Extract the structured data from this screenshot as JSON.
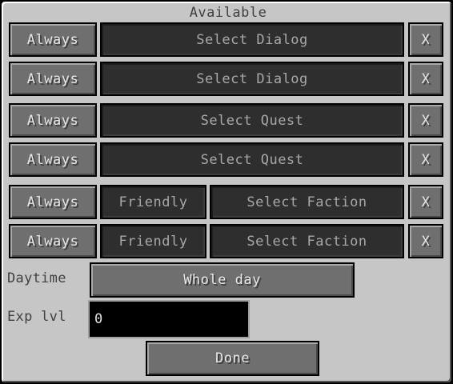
{
  "title": "Available",
  "rows": [
    {
      "availability": "Always",
      "target": "Select Dialog",
      "remove": "X"
    },
    {
      "availability": "Always",
      "target": "Select Dialog",
      "remove": "X"
    },
    {
      "availability": "Always",
      "target": "Select Quest",
      "remove": "X"
    },
    {
      "availability": "Always",
      "target": "Select Quest",
      "remove": "X"
    },
    {
      "availability": "Always",
      "stance": "Friendly",
      "target": "Select Faction",
      "remove": "X"
    },
    {
      "availability": "Always",
      "stance": "Friendly",
      "target": "Select Faction",
      "remove": "X"
    }
  ],
  "daytime": {
    "label": "Daytime",
    "value": "Whole day"
  },
  "exp": {
    "label": "Exp lvl",
    "value": "0"
  },
  "done_label": "Done"
}
